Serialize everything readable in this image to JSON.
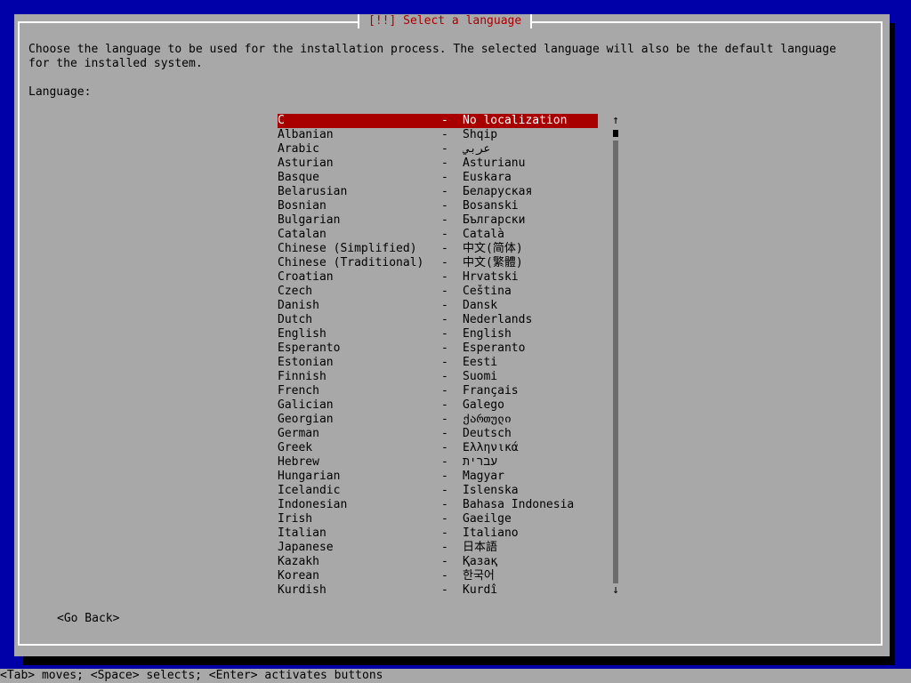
{
  "dialog": {
    "title": "[!!] Select a language",
    "prompt": "Choose the language to be used for the installation process. The selected language will also be the default language\nfor the installed system.",
    "list_label": "Language:",
    "go_back": "<Go Back>"
  },
  "languages": [
    {
      "name": "C",
      "native": "No localization",
      "selected": true
    },
    {
      "name": "Albanian",
      "native": "Shqip"
    },
    {
      "name": "Arabic",
      "native": "عربي"
    },
    {
      "name": "Asturian",
      "native": "Asturianu"
    },
    {
      "name": "Basque",
      "native": "Euskara"
    },
    {
      "name": "Belarusian",
      "native": "Беларуская"
    },
    {
      "name": "Bosnian",
      "native": "Bosanski"
    },
    {
      "name": "Bulgarian",
      "native": "Български"
    },
    {
      "name": "Catalan",
      "native": "Català"
    },
    {
      "name": "Chinese (Simplified)",
      "native": "中文(简体)"
    },
    {
      "name": "Chinese (Traditional)",
      "native": "中文(繁體)"
    },
    {
      "name": "Croatian",
      "native": "Hrvatski"
    },
    {
      "name": "Czech",
      "native": "Čeština"
    },
    {
      "name": "Danish",
      "native": "Dansk"
    },
    {
      "name": "Dutch",
      "native": "Nederlands"
    },
    {
      "name": "English",
      "native": "English"
    },
    {
      "name": "Esperanto",
      "native": "Esperanto"
    },
    {
      "name": "Estonian",
      "native": "Eesti"
    },
    {
      "name": "Finnish",
      "native": "Suomi"
    },
    {
      "name": "French",
      "native": "Français"
    },
    {
      "name": "Galician",
      "native": "Galego"
    },
    {
      "name": "Georgian",
      "native": "ქართული"
    },
    {
      "name": "German",
      "native": "Deutsch"
    },
    {
      "name": "Greek",
      "native": "Ελληνικά"
    },
    {
      "name": "Hebrew",
      "native": "עברית"
    },
    {
      "name": "Hungarian",
      "native": "Magyar"
    },
    {
      "name": "Icelandic",
      "native": "Íslenska"
    },
    {
      "name": "Indonesian",
      "native": "Bahasa Indonesia"
    },
    {
      "name": "Irish",
      "native": "Gaeilge"
    },
    {
      "name": "Italian",
      "native": "Italiano"
    },
    {
      "name": "Japanese",
      "native": "日本語"
    },
    {
      "name": "Kazakh",
      "native": "Қазақ"
    },
    {
      "name": "Korean",
      "native": "한국어"
    },
    {
      "name": "Kurdish",
      "native": "Kurdî"
    }
  ],
  "separator": "-",
  "scrollbar": {
    "up_icon": "↑",
    "down_icon": "↓"
  },
  "help_bar": "<Tab> moves; <Space> selects; <Enter> activates buttons",
  "colors": {
    "background": "#0000a8",
    "dialog": "#a8a8a8",
    "highlight": "#a80000",
    "title_text": "#a80000"
  }
}
